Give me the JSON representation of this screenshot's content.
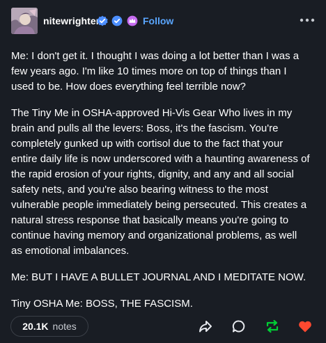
{
  "post": {
    "username": "nitewrighter",
    "follow_label": "Follow",
    "paragraphs": [
      "Me: I don't get it. I thought I was doing a lot better than I was a few years ago. I'm like 10 times more on top of things than I used to be. How does everything feel terrible now?",
      "The Tiny Me in OSHA-approved Hi-Vis Gear Who lives in my brain and pulls all the levers: Boss, it's the fascism. You're completely gunked up with cortisol due to the fact that your entire daily life is now underscored with a haunting awareness of the rapid erosion of your rights, dignity, and any and all social safety nets, and you're also bearing witness to the most vulnerable people immediately being persecuted. This creates a natural stress response that basically means you're going to continue having memory and organizational problems, as well as emotional imbalances.",
      "Me: BUT I HAVE A BULLET JOURNAL AND I MEDITATE NOW.",
      "Tiny OSHA Me: BOSS, THE FASCISM."
    ],
    "notes_count": "20.1K",
    "notes_label": "notes"
  },
  "icons": {
    "badges": [
      "verified-check-icon",
      "verified-check-icon",
      "crown-badge-icon"
    ],
    "more": "more-options-icon",
    "actions": [
      "share-icon",
      "reply-icon",
      "reblog-icon",
      "like-icon"
    ]
  },
  "colors": {
    "background": "#191d24",
    "follow": "#5aa6ff",
    "verified": "#4d8fff",
    "reblog": "#00cf35",
    "like": "#ff4930",
    "crown_badge": "#c66cf0"
  }
}
